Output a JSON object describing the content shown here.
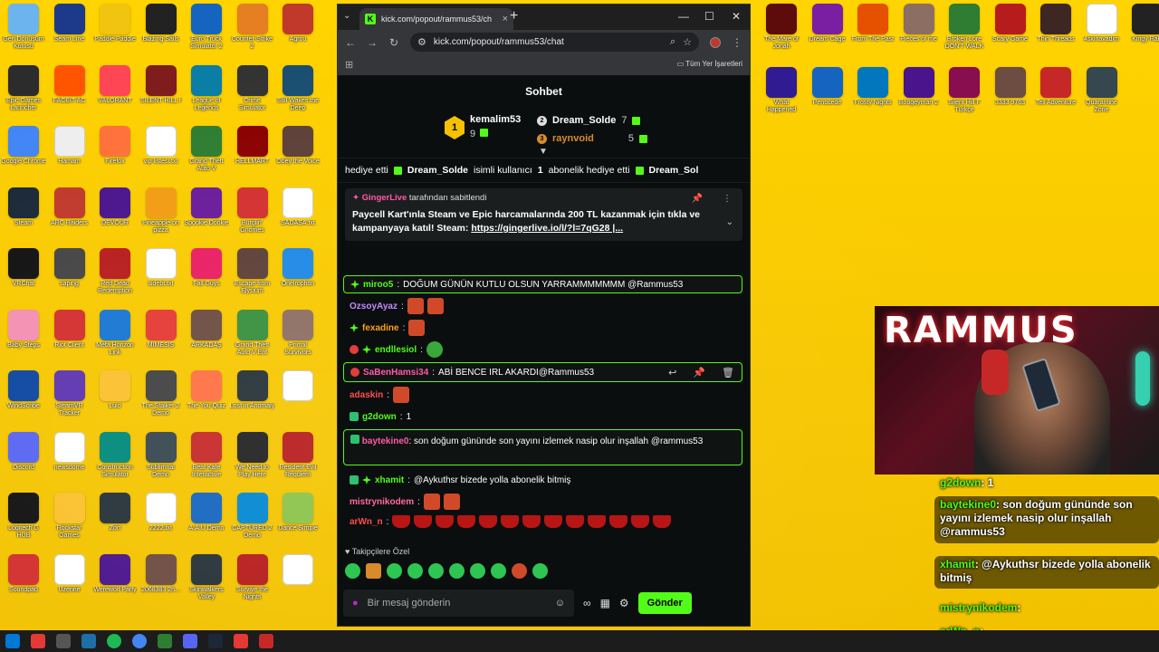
{
  "browser": {
    "tab_title": "kick.com/popout/rammus53/ch",
    "url": "kick.com/popout/rammus53/chat",
    "bookmarks_all": "Tüm Yer İşaretleri"
  },
  "chat": {
    "title": "Sohbet",
    "leaderboard": {
      "first": {
        "name": "kemalim53",
        "count": "9"
      },
      "second": {
        "name": "Dream_Solde",
        "count": "7"
      },
      "third": {
        "name": "raynvoid",
        "count": "5"
      }
    },
    "ticker": {
      "prefix": "hediye etti",
      "gifter": "Dream_Solde",
      "middle": "isimli kullanıcı",
      "count": "1",
      "suffix": "abonelik hediye etti",
      "trail": "Dream_Sol"
    },
    "pinned": {
      "author": "GingerLive",
      "header_suffix": "tarafından sabitlendi",
      "text": "Paycell Kart'ınla Steam ve Epic harcamalarında 200 TL kazanmak için tıkla ve kampanyaya katıl! Steam:",
      "link": "https://gingerlive.io/l/?l=7qG28 |..."
    },
    "messages": [
      {
        "user": "miroo5",
        "color": "#53fc18",
        "text": "DOĞUM GÜNÜN KUTLU OLSUN YARRAMMMMMMM @Rammus53"
      },
      {
        "user": "OzsoyAyaz",
        "color": "#c38bff",
        "text": ""
      },
      {
        "user": "fexadine",
        "color": "#ff9f1c",
        "text": ""
      },
      {
        "user": "endllesiol",
        "color": "#53fc18",
        "text": ""
      },
      {
        "user": "SaBenHamsi34",
        "color": "#ff5aa8",
        "text": "ABİ BENCE IRL AKARDI@Rammus53"
      },
      {
        "user": "adaskin",
        "color": "#ff4d4d",
        "text": ""
      },
      {
        "user": "g2down",
        "color": "#53fc18",
        "text": "1"
      },
      {
        "user": "baytekine0",
        "color": "#ff5aa8",
        "text": "son doğum gününde son yayını izlemek nasip olur inşallah @rammus53"
      },
      {
        "user": "xhamit",
        "color": "#53fc18",
        "text": "@Aykuthsr bizede yolla abonelik bitmiş"
      },
      {
        "user": "mistrynikodem",
        "color": "#ff6b9a",
        "text": ""
      },
      {
        "user": "arWn_n",
        "color": "#ff4d4d",
        "text": ""
      }
    ],
    "followers_title": "Takipçilere Özel",
    "input_placeholder": "Bir mesaj gönderin",
    "send_label": "Gönder"
  },
  "webcam": {
    "banner": "RAMMUS"
  },
  "overlay": [
    {
      "user": "g2down",
      "text": "1"
    },
    {
      "user": "baytekine0",
      "text": "son doğum gününde son yayını izlemek nasip olur inşallah @rammus53"
    },
    {
      "user": "xhamit",
      "text": "@Aykuthsr bizede yolla abonelik bitmiş"
    },
    {
      "user": "mistrynikodem",
      "text": ""
    },
    {
      "user": "arWn_n",
      "text": ""
    }
  ],
  "desktop_icons": [
    [
      "Geri Dönüşüm Kutusu",
      "#6cb4ee"
    ],
    [
      "Seam Line",
      "#1d3a8a"
    ],
    [
      "Paddle Paddle",
      "#f1c40f"
    ],
    [
      "Blazing Sails",
      "#222"
    ],
    [
      "Euro Truck Simulator 2",
      "#1565c0"
    ],
    [
      "Counter-Strike 2",
      "#e67e22"
    ],
    [
      "Agrou",
      "#c0392b"
    ],
    [
      "Epic Games Launcher",
      "#2c2c2c"
    ],
    [
      "FACEIT AC",
      "#ff5500"
    ],
    [
      "VALORANT",
      "#ff4655"
    ],
    [
      "SILENT HILL f",
      "#7f1d1d"
    ],
    [
      "League of Legends",
      "#0a7ea4"
    ],
    [
      "Crime Simulator",
      "#333"
    ],
    [
      "Still Wakes the Deep",
      "#1b4f72"
    ],
    [
      "Google Chrome",
      "#4285f4"
    ],
    [
      "Hamam",
      "#eee"
    ],
    [
      "Firefox",
      "#ff7139"
    ],
    [
      "vip listesi.txt",
      "#fff"
    ],
    [
      "Grand Theft Auto V",
      "#2e7d32"
    ],
    [
      "HELLMART",
      "#8b0000"
    ],
    [
      "Obey the Voice",
      "#5d4037"
    ],
    [
      "Steam",
      "#1b2838"
    ],
    [
      "ARC Raiders",
      "#c0392b"
    ],
    [
      "DEVOUR",
      "#4a148c"
    ],
    [
      "Pineapple on pizza",
      "#f39c12"
    ],
    [
      "Spookie Dookie",
      "#6a1b9a"
    ],
    [
      "Burglin' Gnomes",
      "#d32f2f"
    ],
    [
      "SADASA.txt",
      "#fff"
    ],
    [
      "VRChat",
      "#111"
    ],
    [
      "saping",
      "#444"
    ],
    [
      "Red Dead Redemption",
      "#b71c1c"
    ],
    [
      "sidebt.txt",
      "#fff"
    ],
    [
      "Fall Guys",
      "#e91e63"
    ],
    [
      "Escape from Elysium",
      "#5d4037"
    ],
    [
      "Onelrophon",
      "#1e88e5"
    ],
    [
      "Baby Steps",
      "#f48fb1"
    ],
    [
      "Riot Client",
      "#d32f2f"
    ],
    [
      "Meta Horizon Link",
      "#1976d2"
    ],
    [
      "MIMESIS",
      "#e53935"
    ],
    [
      "ARKADAŞ",
      "#6d4c41"
    ],
    [
      "Grand Theft Auto V Ent",
      "#388e3c"
    ],
    [
      "Primal Survivors",
      "#8d6e63"
    ],
    [
      "WindScribe",
      "#0d47a1"
    ],
    [
      "SteamVR Tracker",
      "#5e35b1"
    ],
    [
      "Lulo",
      "#fbc02d"
    ],
    [
      "The Stalker 2 Demo",
      "#424242"
    ],
    [
      "The You Quiz",
      "#ff7043"
    ],
    [
      "Lost in Anomaly",
      "#263238"
    ],
    [
      "",
      "#fff"
    ],
    [
      "Discord",
      "#5865f2"
    ],
    [
      "newsdome",
      "#fff"
    ],
    [
      "Construction Simulator",
      "#00897b"
    ],
    [
      "Sublimnal Demo",
      "#37474f"
    ],
    [
      "Beat Kafe Interactive",
      "#c62828"
    ],
    [
      "We Need to Play Here",
      "#212121"
    ],
    [
      "Resident Evil Requiem",
      "#b71c1c"
    ],
    [
      "Logitech G HUB",
      "#111"
    ],
    [
      "Rockstar Games",
      "#fbc02d"
    ],
    [
      "Zort",
      "#263238"
    ],
    [
      "2222.txt",
      "#fff"
    ],
    [
      "A.A.U Demo",
      "#1565c0"
    ],
    [
      "CAPTURED 2 Demo",
      "#0288d1"
    ],
    [
      "Dance Simple",
      "#8bc34a"
    ],
    [
      "Soundpad",
      "#d32f2f"
    ],
    [
      "Üzerine",
      "#fff"
    ],
    [
      "Werewolf Party",
      "#4a148c"
    ],
    [
      "2068383 2h...",
      "#6d4c41"
    ],
    [
      "Skinwalkers Valley",
      "#263238"
    ],
    [
      "Survive the Nights",
      "#b71c1c"
    ],
    [
      "",
      "#fff"
    ]
  ],
  "desktop_right_icons": [
    [
      "The Mare of Jonah",
      "#5d0b0b"
    ],
    [
      "Dream Cage",
      "#7b1fa2"
    ],
    [
      "From The Past",
      "#e65100"
    ],
    [
      "Pieces of me",
      "#8d6e63"
    ],
    [
      "Broken Lore DON'T WALK",
      "#2e7d32"
    ],
    [
      "Scary Game",
      "#b71c1c"
    ],
    [
      "Thin Threads",
      "#3e2723"
    ],
    [
      "4skinavadim",
      "#fff"
    ],
    [
      "Kingy Raly",
      "#222"
    ],
    [
      "What Happened",
      "#311b92"
    ],
    [
      "Pensuede",
      "#1565c0"
    ],
    [
      "Frosty Nights",
      "#0277bd"
    ],
    [
      "Boogeyman 2",
      "#4a148c"
    ],
    [
      "Silent Hill F Türkçe",
      "#880e4f"
    ],
    [
      "3333 9763",
      "#6d4c41"
    ],
    [
      "Tell Adventure",
      "#c62828"
    ],
    [
      "Quarantine Zone",
      "#37474f"
    ]
  ]
}
